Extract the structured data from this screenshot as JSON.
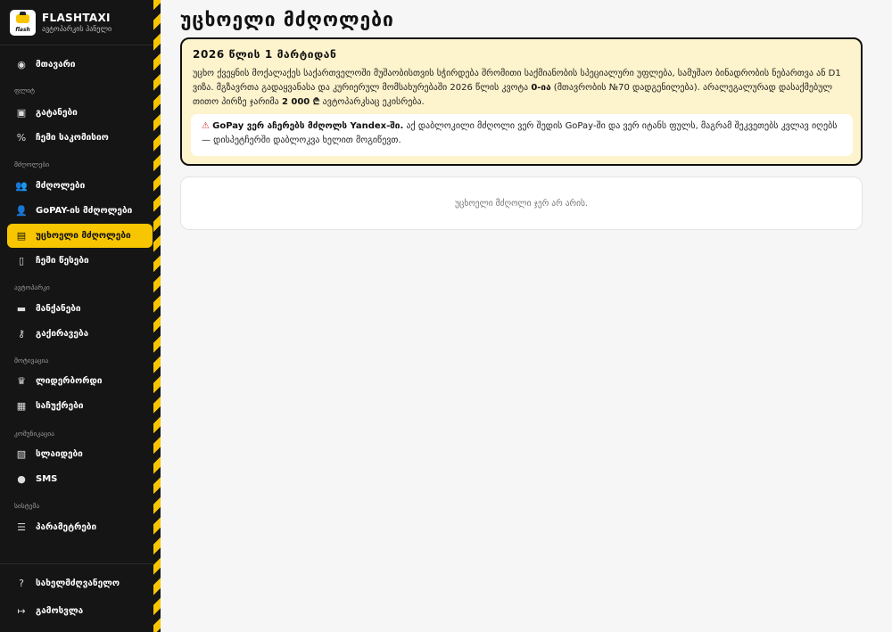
{
  "brand": {
    "name": "FLASHTAXI",
    "subtitle": "ავტოპარკის პანელი",
    "logo_text": "flash"
  },
  "sidebar": {
    "main": {
      "label": "მთავარი",
      "icon": "dashboard-icon"
    },
    "sections": {
      "fleet": "ფლიტ",
      "drivers": "მძღოლები",
      "autopark": "ავტოპარკი",
      "motivation": "მოტივაცია",
      "communication": "კომუნიკაცია",
      "system": "სისტემა"
    },
    "items": {
      "payouts": "გატანები",
      "commission": "ჩემი საკომისიო",
      "drivers": "მძღოლები",
      "gopay_drivers": "GoPAY-ის მძღოლები",
      "foreign_drivers": "უცხოელი მძღოლები",
      "my_rules": "ჩემი წესები",
      "cars": "მანქანები",
      "rent": "გაქირავება",
      "leaderboard": "ლიდერბორდი",
      "gifts": "საჩუქრები",
      "slides": "სლაიდები",
      "sms": "SMS",
      "settings": "პარამეტრები"
    },
    "bottom": {
      "guide": "სახელმძღვანელო",
      "logout": "გამოსვლა"
    }
  },
  "page": {
    "title": "უცხოელი მძღოლები"
  },
  "notice": {
    "title": "2026 წლის 1 მარტიდან",
    "body_1": "უცხო ქვეყნის მოქალაქეს საქართველოში მუშაობისთვის სჭირდება შრომითი საქმიანობის სპეციალური უფლება, სამუშაო ბინადრობის ნებართვა ან D1 ვიზა. მგზავრთა გადაყვანასა და კურიერულ მომსახურებაში 2026 წლის კვოტა",
    "quota": "0-ია",
    "body_2": "(მთავრობის №70 დადგენილება). არალეგალურად დასაქმებულ თითო პირზე ჯარიმა",
    "fine": "2 000 ₾",
    "body_3": "ავტოპარკსაც ეკისრება.",
    "warning_icon": "⚠",
    "warning_bold": "GoPay ვერ აჩერებს მძღოლს Yandex-ში.",
    "warning_text": "აქ დაბლოკილი მძღოლი ვერ შედის GoPay-ში და ვერ იტანს ფულს, მაგრამ შეკვეთებს კვლავ იღებს — დისპეტჩერში დაბლოკვა ხელით მოგიწევთ."
  },
  "empty_state": {
    "text": "უცხოელი მძღოლი ჯერ არ არის."
  },
  "colors": {
    "accent": "#f7c600",
    "sidebar_bg": "#151515",
    "notice_bg": "#fdf3cc"
  }
}
